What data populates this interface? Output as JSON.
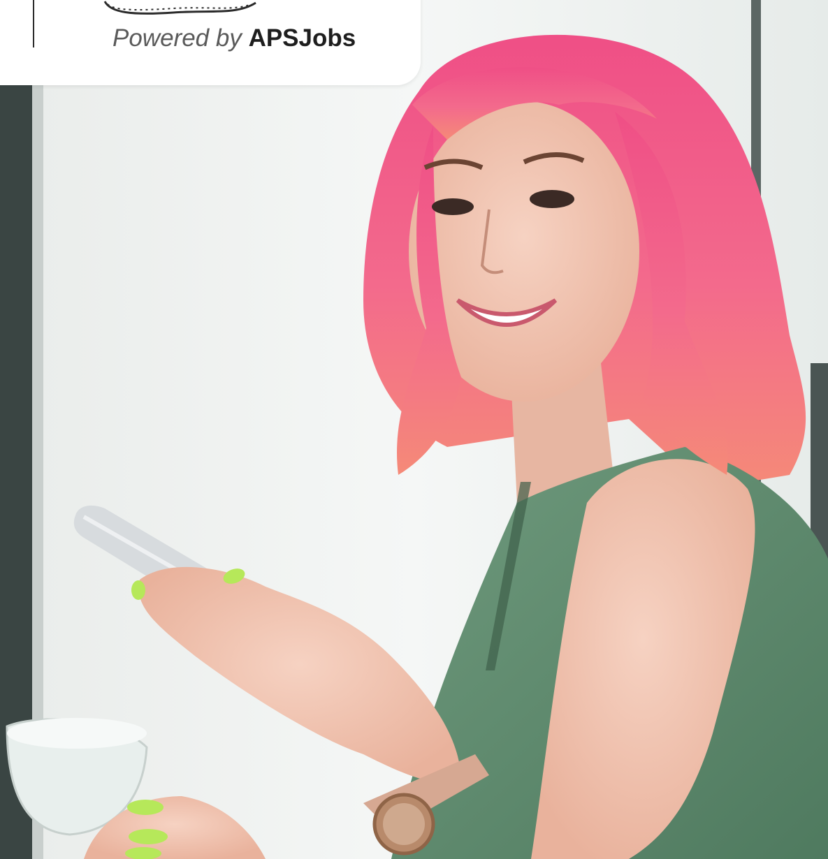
{
  "badge": {
    "lead_text": "Powered by",
    "brand_text": "APSJobs"
  },
  "colors": {
    "badge_background": "#ffffff",
    "hair": "#f36a8c",
    "shirt": "#5e8a6e",
    "nails": "#b6e85a"
  },
  "icons": {
    "logo_mark": "film-strip-logo"
  }
}
